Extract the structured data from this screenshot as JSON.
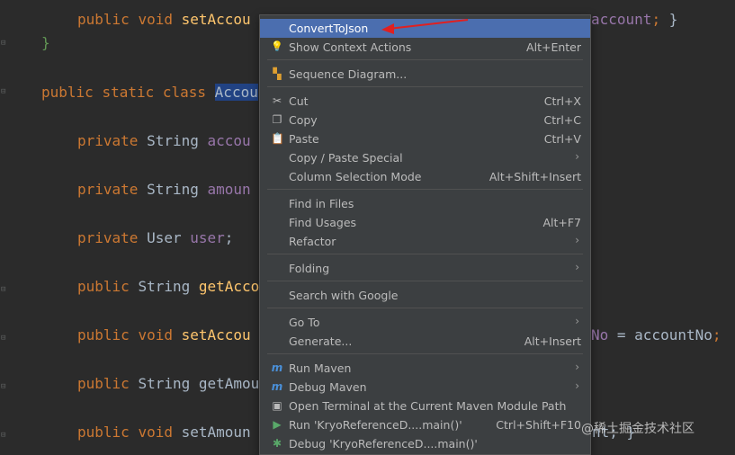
{
  "editor": {
    "lines": [
      {
        "parts": [
          [
            "kw",
            "public "
          ],
          [
            "kw",
            "void "
          ],
          [
            "fn",
            "setAccou"
          ]
        ]
      },
      {
        "parts": [
          [
            "br",
            "}"
          ]
        ]
      },
      {
        "parts": [
          [
            "kw",
            "public "
          ],
          [
            "kw",
            "static "
          ],
          [
            "kw",
            "class "
          ],
          [
            "sel",
            "Accou"
          ]
        ]
      },
      {
        "parts": [
          [
            "kw",
            "private "
          ],
          [
            "ty",
            "String "
          ],
          [
            "fd",
            "accou"
          ]
        ]
      },
      {
        "parts": [
          [
            "kw",
            "private "
          ],
          [
            "ty",
            "String "
          ],
          [
            "fd",
            "amoun"
          ]
        ]
      },
      {
        "parts": [
          [
            "kw",
            "private "
          ],
          [
            "ty",
            "User "
          ],
          [
            "fd",
            "user"
          ],
          [
            "pn",
            ";"
          ]
        ]
      },
      {
        "parts": [
          [
            "kw",
            "public "
          ],
          [
            "ty",
            "String "
          ],
          [
            "fn",
            "getAcco"
          ]
        ]
      },
      {
        "parts": [
          [
            "kw",
            "public "
          ],
          [
            "kw",
            "void "
          ],
          [
            "fn",
            "setAccou"
          ]
        ]
      },
      {
        "parts": [
          [
            "kw",
            "public "
          ],
          [
            "ty",
            "String "
          ],
          [
            "ty",
            "getAmou"
          ]
        ]
      },
      {
        "parts": [
          [
            "kw",
            "public "
          ],
          [
            "kw",
            "void "
          ],
          [
            "ty",
            "setAmoun"
          ]
        ]
      }
    ],
    "tail_account": "account; }",
    "tail_accountno": "No = accountNo;",
    "tail_last": "nt; }"
  },
  "menu": {
    "items": [
      {
        "name": "convert-to-json",
        "label": "ConvertToJson",
        "shortcut": "",
        "icon": "",
        "highlighted": true
      },
      {
        "name": "show-context-actions",
        "label": "Show Context Actions",
        "shortcut": "Alt+Enter",
        "icon": "bulb-icon"
      },
      {
        "name": "sequence-diagram",
        "label": "Sequence Diagram...",
        "shortcut": "",
        "icon": "sequence-diagram-icon"
      },
      {
        "name": "cut",
        "label": "Cut",
        "shortcut": "Ctrl+X",
        "icon": "scissors-icon"
      },
      {
        "name": "copy",
        "label": "Copy",
        "shortcut": "Ctrl+C",
        "icon": "copy-icon"
      },
      {
        "name": "paste",
        "label": "Paste",
        "shortcut": "Ctrl+V",
        "icon": "clipboard-icon"
      },
      {
        "name": "copy-paste-special",
        "label": "Copy / Paste Special",
        "shortcut": "",
        "icon": "",
        "submenu": true
      },
      {
        "name": "column-selection-mode",
        "label": "Column Selection Mode",
        "shortcut": "Alt+Shift+Insert",
        "icon": ""
      },
      {
        "name": "find-in-files",
        "label": "Find in Files",
        "shortcut": "",
        "icon": ""
      },
      {
        "name": "find-usages",
        "label": "Find Usages",
        "shortcut": "Alt+F7",
        "icon": ""
      },
      {
        "name": "refactor",
        "label": "Refactor",
        "shortcut": "",
        "icon": "",
        "submenu": true
      },
      {
        "name": "folding",
        "label": "Folding",
        "shortcut": "",
        "icon": "",
        "submenu": true
      },
      {
        "name": "search-with-google",
        "label": "Search with Google",
        "shortcut": "",
        "icon": ""
      },
      {
        "name": "go-to",
        "label": "Go To",
        "shortcut": "",
        "icon": "",
        "submenu": true
      },
      {
        "name": "generate",
        "label": "Generate...",
        "shortcut": "Alt+Insert",
        "icon": ""
      },
      {
        "name": "run-maven",
        "label": "Run Maven",
        "shortcut": "",
        "icon": "maven-icon",
        "submenu": true
      },
      {
        "name": "debug-maven",
        "label": "Debug Maven",
        "shortcut": "",
        "icon": "maven-icon",
        "submenu": true
      },
      {
        "name": "open-terminal",
        "label": "Open Terminal at the Current Maven Module Path",
        "shortcut": "",
        "icon": "terminal-icon"
      },
      {
        "name": "run-main",
        "label": "Run 'KryoReferenceD....main()'",
        "shortcut": "Ctrl+Shift+F10",
        "icon": "run-icon"
      },
      {
        "name": "debug-main",
        "label": "Debug 'KryoReferenceD....main()'",
        "shortcut": "",
        "icon": "debug-icon"
      }
    ],
    "submenu_arrow": "›"
  },
  "icons": {
    "bulb-icon": "💡",
    "sequence-diagram-icon": "▚",
    "scissors-icon": "✂",
    "copy-icon": "❐",
    "clipboard-icon": "📋",
    "maven-icon": "m",
    "terminal-icon": "▣",
    "run-icon": "▶",
    "debug-icon": "✱"
  },
  "colors": {
    "highlight": "#4b6eaf",
    "annotation_arrow": "#e02020"
  },
  "watermark": "@稀土掘金技术社区"
}
